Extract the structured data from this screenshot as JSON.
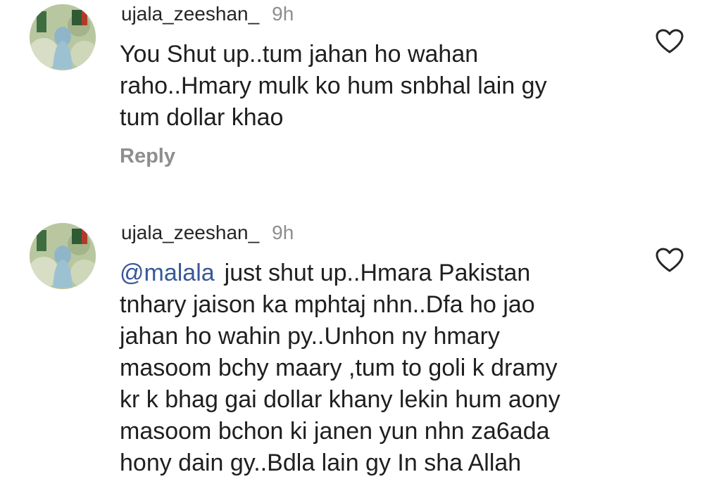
{
  "comments": [
    {
      "username": "ujala_zeeshan_",
      "time": "9h",
      "mention": "",
      "lines": [
        "You Shut up..tum jahan ho wahan",
        "raho..Hmary mulk ko hum snbhal lain gy",
        "tum dollar khao"
      ],
      "reply_label": "Reply",
      "like_icon": "heart-outline-icon"
    },
    {
      "username": "ujala_zeeshan_",
      "time": "9h",
      "mention": "@malala",
      "lines": [
        "just shut up..Hmara Pakistan",
        "tnhary jaison ka mphtaj nhn..Dfa ho jao",
        "jahan ho wahin py..Unhon ny hmary",
        "masoom bchy maary ,tum to goli k dramy",
        "kr k bhag gai dollar khany lekin hum aony",
        "masoom bchon ki janen yun nhn za6ada",
        "hony dain gy..Bdla lain gy In sha Allah"
      ],
      "like_icon": "heart-outline-icon"
    }
  ],
  "colors": {
    "username": "#262626",
    "meta_gray": "#8e8e8e",
    "mention": "#385898",
    "text": "#1f1f1f"
  }
}
